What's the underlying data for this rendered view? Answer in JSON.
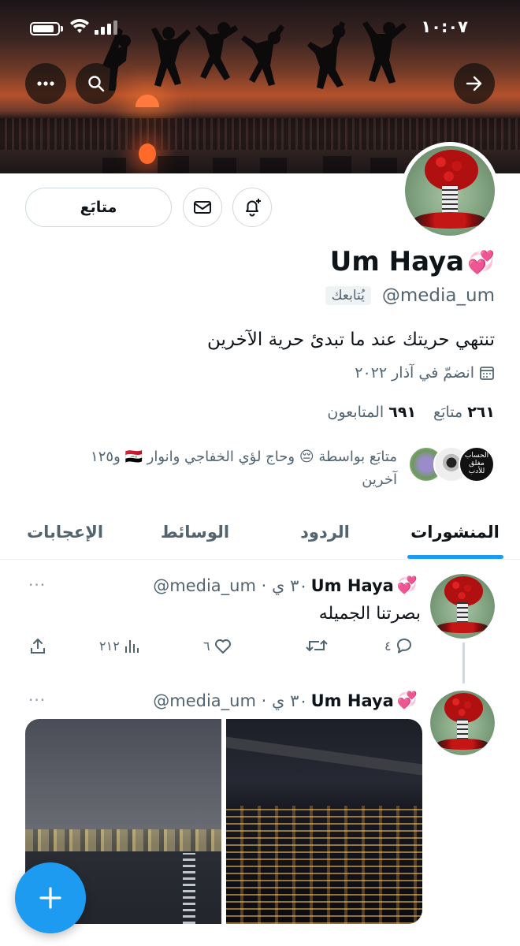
{
  "status_bar": {
    "time": "١٠:٠٧"
  },
  "header": {
    "icons": [
      "more-icon",
      "search-icon",
      "back-arrow-icon"
    ]
  },
  "profile": {
    "display_name": "Um Haya",
    "name_emoji": "💞",
    "handle": "@media_um",
    "follows_you_badge": "يُتابعك",
    "bio": "تنتهي حريتك عند ما تبدئ حرية الآخرين",
    "joined": "انضمّ في آذار ٢٠٢٢",
    "following_count": "٢٦١",
    "following_label": "متابَع",
    "followers_count": "٦٩١",
    "followers_label": "المتابعون",
    "followed_by_text": "متابَع بواسطة 😔 وحاج لؤي الخفاجي وانوار 🇮🇶 و١٢٥ آخرين",
    "follow_button_label": "متابَع",
    "fav3_text": "الحساب مغلق للأدب"
  },
  "tabs": [
    {
      "label": "المنشورات",
      "active": true
    },
    {
      "label": "الردود",
      "active": false
    },
    {
      "label": "الوسائط",
      "active": false
    },
    {
      "label": "الإعجابات",
      "active": false
    }
  ],
  "posts": [
    {
      "name": "Um Haya",
      "emoji": "💞",
      "handle_time": "@media_um · ٣٠ ي",
      "text": "بصرتنا الجميله",
      "replies": "٤",
      "likes": "٦",
      "views": "٢١٢"
    },
    {
      "name": "Um Haya",
      "emoji": "💞",
      "handle_time": "@media_um · ٣٠ ي"
    }
  ],
  "fab_label": "+",
  "more_dots": "···"
}
